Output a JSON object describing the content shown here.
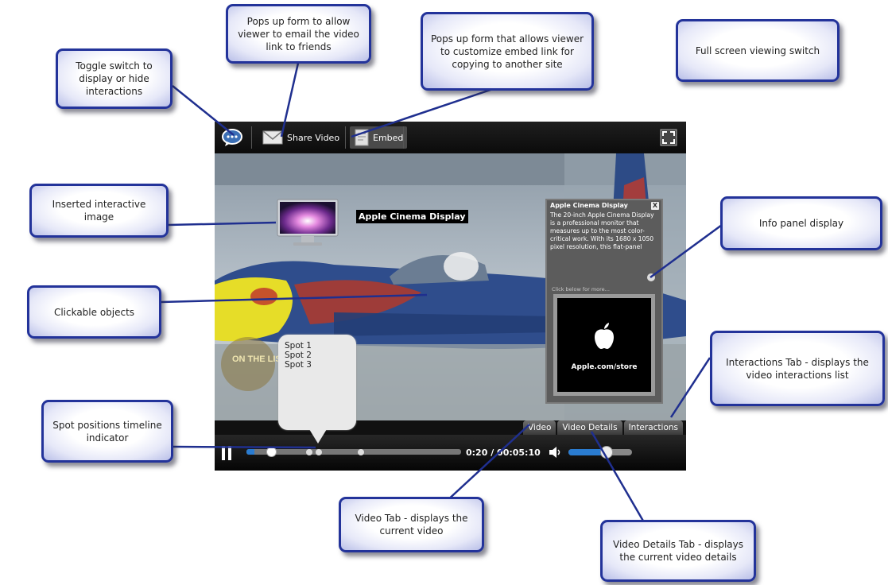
{
  "callouts": {
    "toggle": "Toggle switch to display or hide interactions",
    "share": "Pops up form to allow viewer to email the video link to friends",
    "embed": "Pops up form that allows viewer to customize embed link for copying to another site",
    "fullscreen": "Full screen viewing switch",
    "inserted_image": "Inserted interactive image",
    "info_panel": "Info panel display",
    "clickable": "Clickable objects",
    "interactions_tab": "Interactions Tab - displays the video interactions list",
    "spot_positions": "Spot positions timeline indicator",
    "video_tab": "Video Tab - displays the current video",
    "video_details_tab": "Video Details Tab - displays the current video details"
  },
  "player": {
    "toolbar": {
      "share_label": "Share Video",
      "embed_label": "Embed"
    },
    "hotspot_label": "Apple Cinema Display",
    "info_panel": {
      "title": "Apple Cinema Display",
      "close": "X",
      "body": "The 20-inch Apple Cinema Display is a professional monitor that measures up to the most color-critical work. With its 1680 x 1050 pixel resolution, this flat-panel",
      "more": "Click below for more...",
      "ad_text": "Apple.com/store"
    },
    "spots": [
      "Spot 1",
      "Spot 2",
      "Spot 3"
    ],
    "tabs": [
      "Video",
      "Video Details",
      "Interactions"
    ],
    "time": "0:20 / 00:05:10",
    "video_overlay_text": "ON THE LIS",
    "playback": {
      "progress_fraction": 0.038,
      "volume_fraction": 0.6
    }
  },
  "colors": {
    "callout_border": "#23339a",
    "leader_line": "#1f2f8f",
    "player_bg": "#111111"
  },
  "icons": [
    "comment-icon",
    "mail-icon",
    "document-icon",
    "fullscreen-icon",
    "pause-icon",
    "speaker-icon",
    "apple-logo-icon",
    "monitor-icon"
  ]
}
